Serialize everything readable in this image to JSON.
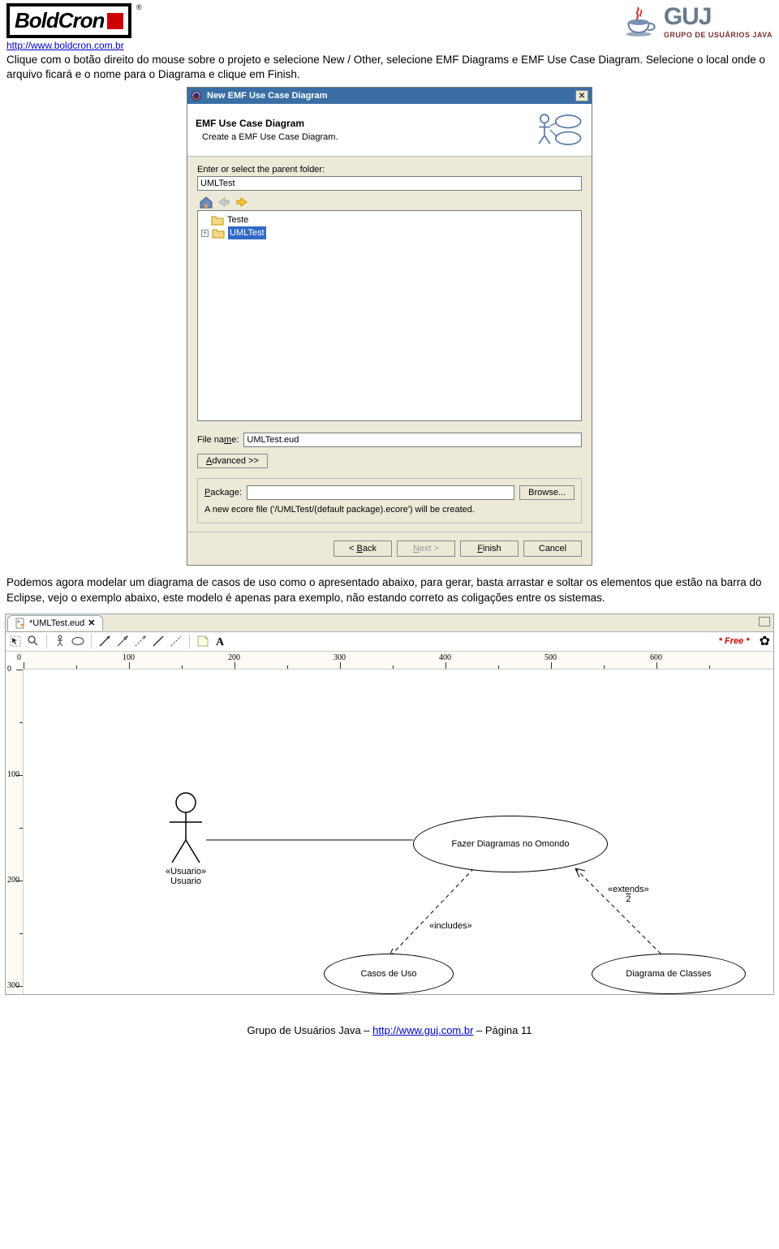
{
  "header": {
    "boldcron_text": "BoldCron",
    "reg": "®",
    "boldcron_url": "http://www.boldcron.com.br",
    "guj_big": "GUJ",
    "guj_sub": "GRUPO DE USUÁRIOS JAVA"
  },
  "paragraph1": "Clique com o botão direito do mouse sobre o projeto e selecione New / Other, selecione EMF Diagrams e EMF Use Case Diagram. Selecione o local onde o arquivo ficará e o nome para o Diagrama e clique em Finish.",
  "dialog": {
    "title": "New EMF Use Case Diagram",
    "banner_title": "EMF Use Case Diagram",
    "banner_sub": "Create a EMF Use Case Diagram.",
    "parent_label": "Enter or select the parent folder:",
    "parent_value": "UMLTest",
    "tree": {
      "item1": "Teste",
      "item2": "UMLTest"
    },
    "filename_label_pre": "File na",
    "filename_label_u": "m",
    "filename_label_post": "e:",
    "filename_value": "UMLTest.eud",
    "advanced_label": "Advanced >>",
    "package_label_u": "P",
    "package_label_post": "ackage:",
    "package_value": "",
    "browse_label": "Browse...",
    "package_note": "A new ecore file ('/UMLTest/(default package).ecore') will be created.",
    "back": "< Back",
    "next": "Next >",
    "finish": "Finish",
    "cancel": "Cancel"
  },
  "paragraph2": "Podemos agora modelar um diagrama de casos de uso como o apresentado abaixo, para gerar, basta arrastar e soltar os elementos que estão na barra do Eclipse, vejo o exemplo abaixo, este modelo é apenas para exemplo, não estando correto as coligações entre os sistemas.",
  "editor": {
    "tab_label": "*UMLTest.eud",
    "free": "* Free *",
    "ruler_h": [
      "0",
      "100",
      "200",
      "300",
      "400",
      "500",
      "600"
    ],
    "ruler_v": [
      "0",
      "100",
      "200",
      "300"
    ],
    "actor_stereotype": "«Usuario»",
    "actor_name": "Usuario",
    "uc1": "Fazer Diagramas no Omondo",
    "uc2": "Casos de Uso",
    "uc3": "Diagrama de Classes",
    "includes": "«includes»",
    "extends": "«extends»",
    "extends_num": "2"
  },
  "footer": {
    "pre": "Grupo de Usuários Java – ",
    "link": "http://www.guj.com.br",
    "post": " – Página 11"
  }
}
